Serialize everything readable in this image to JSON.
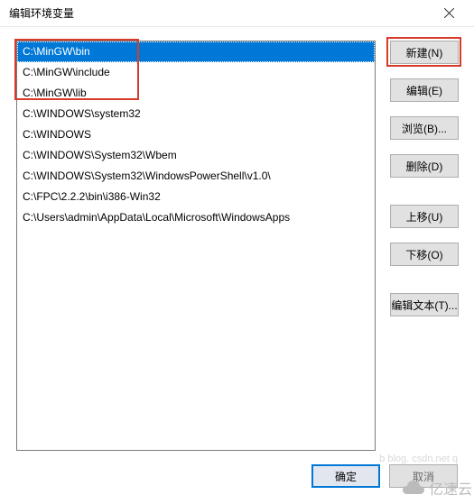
{
  "title": "编辑环境变量",
  "list": {
    "selected_index": 0,
    "items": [
      "C:\\MinGW\\bin",
      "C:\\MinGW\\include",
      "C:\\MinGW\\lib",
      "C:\\WINDOWS\\system32",
      "C:\\WINDOWS",
      "C:\\WINDOWS\\System32\\Wbem",
      "C:\\WINDOWS\\System32\\WindowsPowerShell\\v1.0\\",
      "C:\\FPC\\2.2.2\\bin\\i386-Win32",
      "C:\\Users\\admin\\AppData\\Local\\Microsoft\\WindowsApps"
    ]
  },
  "buttons": {
    "new": "新建(N)",
    "edit": "编辑(E)",
    "browse": "浏览(B)...",
    "delete": "删除(D)",
    "moveup": "上移(U)",
    "movedown": "下移(O)",
    "edittext": "编辑文本(T)..."
  },
  "footer": {
    "ok": "确定",
    "cancel": "取消"
  },
  "watermark": {
    "text": "亿速云",
    "sub": "b blog. csdn.net     q"
  },
  "highlight_color": "#d83b2a"
}
